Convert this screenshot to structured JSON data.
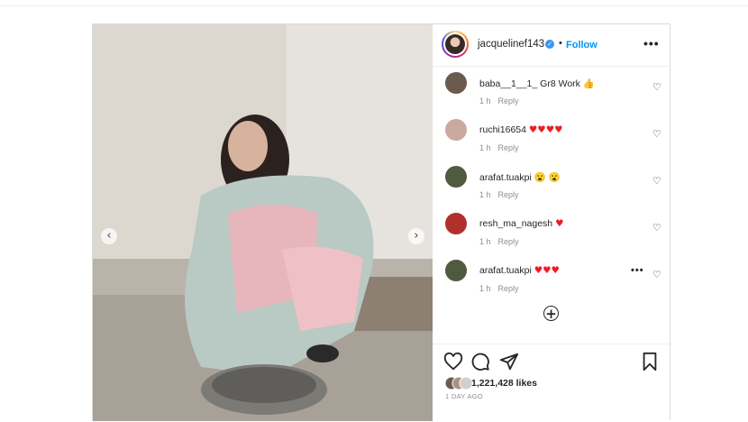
{
  "post": {
    "username": "jacquelinef143",
    "separator": "•",
    "follow_label": "Follow",
    "more_label": "•••",
    "media": {
      "prev_icon": "chevron-left-icon",
      "next_icon": "chevron-right-icon",
      "prev_glyph": "‹",
      "next_glyph": "›"
    },
    "comments": [
      {
        "user": "baba__1__1_",
        "text": "Gr8 Work 👍",
        "time": "1 h",
        "reply": "Reply",
        "avatar_color": "#6b5a4e",
        "hearts": 0,
        "has_more": false
      },
      {
        "user": "ruchi16654",
        "text": "",
        "time": "1 h",
        "reply": "Reply",
        "avatar_color": "#c9a9a0",
        "hearts": 4,
        "has_more": false
      },
      {
        "user": "arafat.tuakpi",
        "text": "😮 😮",
        "time": "1 h",
        "reply": "Reply",
        "avatar_color": "#4f5a3e",
        "hearts": 0,
        "has_more": false
      },
      {
        "user": "resh_ma_nagesh",
        "text": "",
        "time": "1 h",
        "reply": "Reply",
        "avatar_color": "#b0302c",
        "hearts": 1,
        "has_more": false
      },
      {
        "user": "arafat.tuakpi",
        "text": "",
        "time": "1 h",
        "reply": "Reply",
        "avatar_color": "#4f5a3e",
        "hearts": 3,
        "has_more": true
      }
    ],
    "load_more_icon": "plus-circle-icon",
    "load_more_glyph": "+",
    "likes_text": "1,221,428 likes",
    "time_ago": "1 DAY AGO",
    "heart_glyph": "♥",
    "comment_heart_glyph": "♡",
    "colors": {
      "accent": "#0095f6",
      "verified": "#3897f0",
      "heart": "#ed1c24"
    }
  }
}
